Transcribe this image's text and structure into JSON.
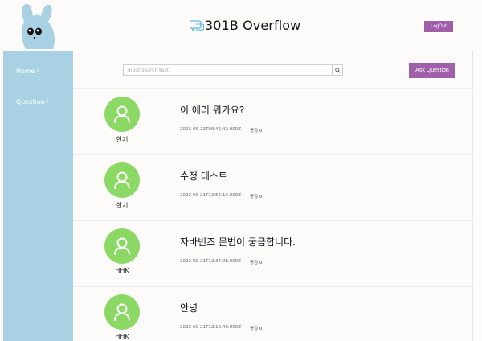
{
  "header": {
    "title": "301B Overflow",
    "logout_label": "LogOut"
  },
  "sidebar": {
    "items": [
      {
        "label": "Home",
        "arrow": "⇩"
      },
      {
        "label": "Question",
        "arrow": "⇩"
      }
    ]
  },
  "toolbar": {
    "search_placeholder": "input search text",
    "ask_label": "Ask Question"
  },
  "questions": [
    {
      "author": "현기",
      "title": "이 에러 뭐가요?",
      "date": "2022-09-22T00:46:42.000Z",
      "likes": "공감 0"
    },
    {
      "author": "현기",
      "title": "수정 테스트",
      "date": "2022-09-21T12:55:13.000Z",
      "likes": "공감 0"
    },
    {
      "author": "HHK",
      "title": "자바빈즈 문법이 궁금합니다.",
      "date": "2022-09-21T12:37:08.000Z",
      "likes": "공감 0"
    },
    {
      "author": "HHK",
      "title": "안녕",
      "date": "2022-09-21T12:16:40.000Z",
      "likes": "공감 0"
    }
  ],
  "colors": {
    "accent": "#9f5fa9",
    "sidebar": "#a8d1e3",
    "avatar": "#8bd865"
  }
}
